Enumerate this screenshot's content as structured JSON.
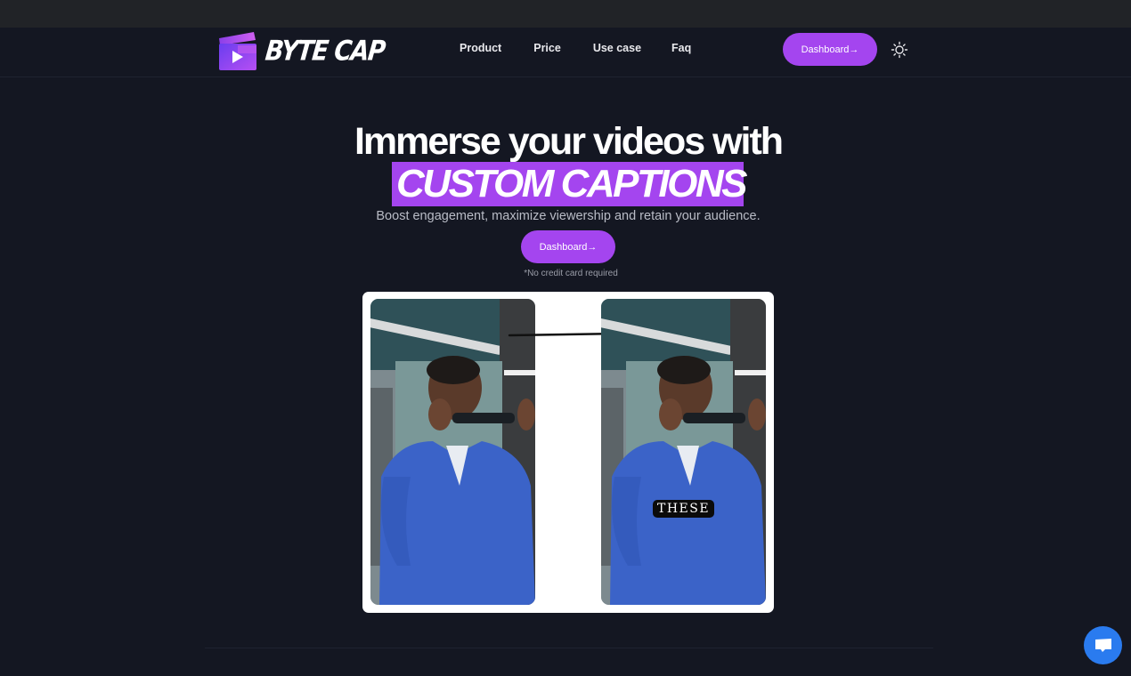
{
  "brand": {
    "name": "BYTE CAP",
    "accent_color": "#a445ef"
  },
  "nav": {
    "items": [
      {
        "label": "Product"
      },
      {
        "label": "Price"
      },
      {
        "label": "Use case"
      },
      {
        "label": "Faq"
      }
    ],
    "cta_label": "Dashboard→",
    "theme_icon": "sun-icon"
  },
  "hero": {
    "title_line1": "Immerse your videos with",
    "title_highlight": "CUSTOM CAPTIONS",
    "subtitle": "Boost engagement, maximize viewership and retain your audience.",
    "cta_label": "Dashboard→",
    "note": "*No credit card required"
  },
  "demo": {
    "before_label": "",
    "after_caption": "THESE",
    "arrow_icon": "arrow-right-icon"
  },
  "chat": {
    "icon": "chat-bubble-icon",
    "color": "#2a7bef"
  }
}
